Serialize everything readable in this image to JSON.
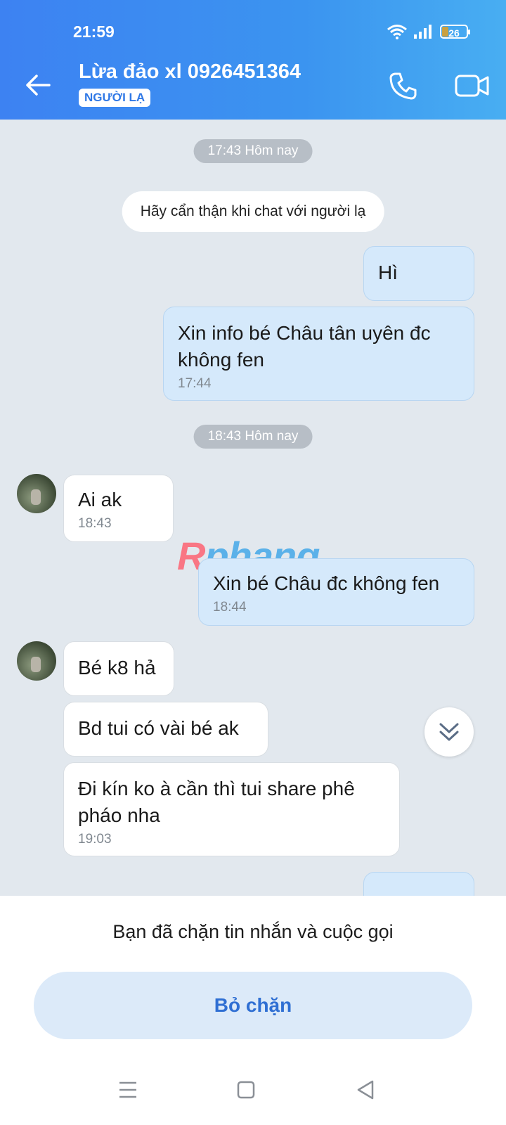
{
  "status_bar": {
    "time": "21:59",
    "battery": "26",
    "battery_level": 0.26
  },
  "header": {
    "title": "Lừa đảo xl 0926451364",
    "badge": "NGƯỜI LẠ",
    "icons": [
      "back-arrow-icon",
      "phone-icon",
      "video-camera-icon"
    ]
  },
  "chat": {
    "separator_1": "17:43 Hôm nay",
    "notice": "Hãy cẩn thận khi chat với người lạ",
    "messages": [
      {
        "dir": "out",
        "text": "Hì",
        "time": ""
      },
      {
        "dir": "out",
        "text": "Xin info bé Châu tân uyên đc không fen",
        "time": "17:44"
      },
      {
        "dir": "in",
        "text": "Ai ak",
        "time": "18:43"
      },
      {
        "dir": "out",
        "text": "Xin bé Châu đc không fen",
        "time": "18:44"
      },
      {
        "dir": "in",
        "text": "Bé k8 hả",
        "time": ""
      },
      {
        "dir": "in",
        "text": "Bd tui có vài bé ak",
        "time": ""
      },
      {
        "dir": "in",
        "text": "Đi kín ko à cần thì tui share phê pháo nha",
        "time": "19:03"
      }
    ],
    "separator_2": "18:43 Hôm nay",
    "watermark_first": "R",
    "watermark_rest": "phang"
  },
  "bottom": {
    "blocked_text": "Bạn đã chặn tin nhắn và cuộc gọi",
    "unblock_label": "Bỏ chặn"
  },
  "colors": {
    "header_start": "#3d82f2",
    "header_end": "#48aef2",
    "outgoing_bubble": "#d5e9fb",
    "incoming_bubble": "#ffffff",
    "chat_bg": "#e2e8ee",
    "accent": "#2f6fd3"
  }
}
